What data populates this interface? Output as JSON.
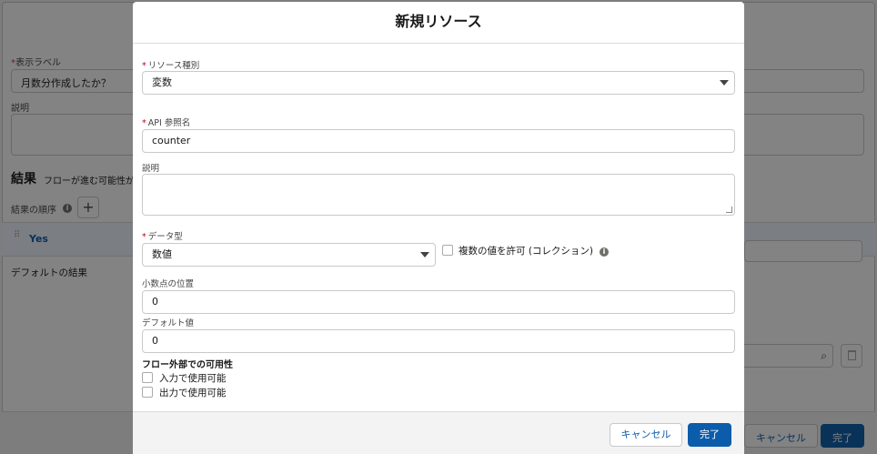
{
  "background": {
    "display_label": "表示ラベル",
    "display_value": "月数分作成したか？",
    "description_label": "説明",
    "results_title": "結果",
    "results_hint": "フローが進む可能性があ",
    "result_order_label": "結果の順序",
    "outcome_name": "Yes",
    "default_result_label": "デフォルトの結果",
    "cancel_label": "キャンセル",
    "done_label": "完了"
  },
  "modal": {
    "title": "新規リソース",
    "resource_type_label": "リソース種別",
    "resource_type_value": "変数",
    "api_name_label": "API 参照名",
    "api_name_value": "counter",
    "description_label": "説明",
    "data_type_label": "データ型",
    "data_type_value": "数値",
    "allow_multiple_label": "複数の値を許可 (コレクション)",
    "decimal_places_label": "小数点の位置",
    "decimal_places_value": "0",
    "default_value_label": "デフォルト値",
    "default_value_value": "0",
    "availability_title": "フロー外部での可用性",
    "available_input_label": "入力で使用可能",
    "available_output_label": "出力で使用可能",
    "cancel_label": "キャンセル",
    "done_label": "完了"
  }
}
